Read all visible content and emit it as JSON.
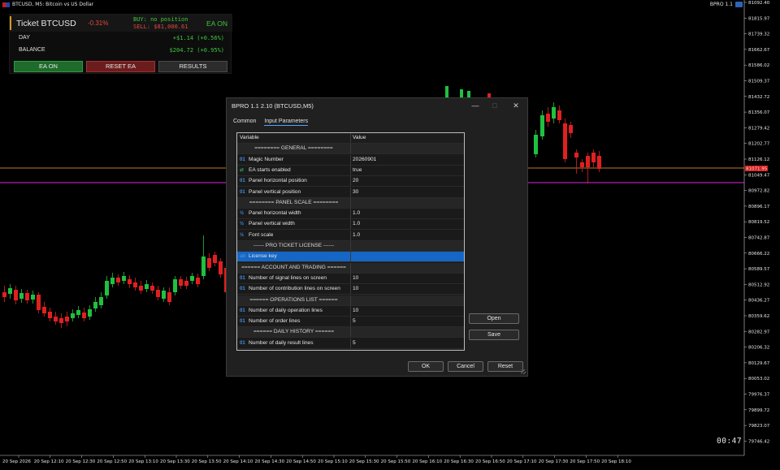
{
  "chart": {
    "title": "BTCUSD, M5:  Bitcoin vs US Dollar",
    "tag": "BPRO 1.1",
    "timer": "00:47",
    "colors": {
      "bull": "#20c040",
      "bear": "#e02020",
      "line_orange": "#ff9e3d",
      "line_magenta": "#e028e0",
      "price_label": "#d81e1e"
    },
    "price_labels": [
      "81092.40",
      "81815.97",
      "81739.32",
      "81662.67",
      "81586.02",
      "81509.37",
      "81432.72",
      "81356.07",
      "81279.42",
      "81202.77",
      "81126.12",
      "81049.47",
      "80972.82",
      "80896.17",
      "80819.52",
      "80742.87",
      "80666.22",
      "80589.57",
      "80512.92",
      "80436.27",
      "80359.62",
      "80282.97",
      "80206.32",
      "80129.67",
      "80053.02",
      "79976.37",
      "79899.72",
      "79823.07",
      "79746.42"
    ],
    "current_price": "81071.95",
    "time_labels": [
      "20 Sep 2026",
      "20 Sep 12:10",
      "20 Sep 12:30",
      "20 Sep 12:50",
      "20 Sep 13:10",
      "20 Sep 13:30",
      "20 Sep 13:50",
      "20 Sep 14:10",
      "20 Sep 14:30",
      "20 Sep 14:50",
      "20 Sep 15:10",
      "20 Sep 15:30",
      "20 Sep 15:50",
      "20 Sep 16:10",
      "20 Sep 16:30",
      "20 Sep 16:50",
      "20 Sep 17:10",
      "20 Sep 17:30",
      "20 Sep 17:50",
      "20 Sep 18:10"
    ]
  },
  "ticket": {
    "title": "Ticket BTCUSD",
    "change": "-0.31%",
    "buy": "BUY:  no position",
    "sell": "SELL: $81,000.61",
    "ea_state": "EA ON",
    "rows": [
      {
        "label": "DAY",
        "value": "+$1.14 (+0.56%)"
      },
      {
        "label": "BALANCE",
        "value": "$204.72 (+0.95%)"
      }
    ],
    "buttons": {
      "ea_on": "EA ON",
      "reset_ea": "RESET EA",
      "results": "RESULTS"
    }
  },
  "dialog": {
    "title": "BPRO 1.1 2.10 (BTCUSD,M5)",
    "tabs": [
      "Common",
      "Input Parameters"
    ],
    "columns": {
      "variable": "Variable",
      "value": "Value"
    },
    "rows": [
      {
        "type": "section",
        "variable": "======== GENERAL ========",
        "value": ""
      },
      {
        "type": "param",
        "icon": "01",
        "variable": "Magic Number",
        "value": "20260901"
      },
      {
        "type": "param",
        "icon": "bool",
        "variable": "EA starts enabled",
        "value": "true"
      },
      {
        "type": "param",
        "icon": "01",
        "variable": "Panel horizontal position",
        "value": "20"
      },
      {
        "type": "param",
        "icon": "01",
        "variable": "Panel vertical position",
        "value": "30"
      },
      {
        "type": "section",
        "variable": "======== PANEL SCALE ========",
        "value": ""
      },
      {
        "type": "param",
        "icon": "½",
        "variable": "Panel horizontal width",
        "value": "1.0"
      },
      {
        "type": "param",
        "icon": "½",
        "variable": "Panel vertical width",
        "value": "1.0"
      },
      {
        "type": "param",
        "icon": "½",
        "variable": "Font scale",
        "value": "1.0"
      },
      {
        "type": "section",
        "variable": "------ PRO TICKET LICENSE ------",
        "value": ""
      },
      {
        "type": "param",
        "icon": "ab",
        "variable": "License key",
        "value": "",
        "selected": true
      },
      {
        "type": "section",
        "variable": "====== ACCOUNT AND TRADING ======",
        "value": ""
      },
      {
        "type": "param",
        "icon": "01",
        "variable": "Number of signal lines on screen",
        "value": "10"
      },
      {
        "type": "param",
        "icon": "01",
        "variable": "Number of contribution lines on screen",
        "value": "10"
      },
      {
        "type": "section",
        "variable": "====== OPERATIONS LIST ======",
        "value": ""
      },
      {
        "type": "param",
        "icon": "01",
        "variable": "Number of daily operation lines",
        "value": "10"
      },
      {
        "type": "param",
        "icon": "01",
        "variable": "Number of order lines",
        "value": "5"
      },
      {
        "type": "section",
        "variable": "====== DAILY HISTORY ======",
        "value": ""
      },
      {
        "type": "param",
        "icon": "01",
        "variable": "Number of daily result lines",
        "value": "5"
      }
    ],
    "side_buttons": {
      "open": "Open",
      "save": "Save"
    },
    "footer_buttons": {
      "ok": "OK",
      "cancel": "Cancel",
      "reset": "Reset"
    }
  }
}
